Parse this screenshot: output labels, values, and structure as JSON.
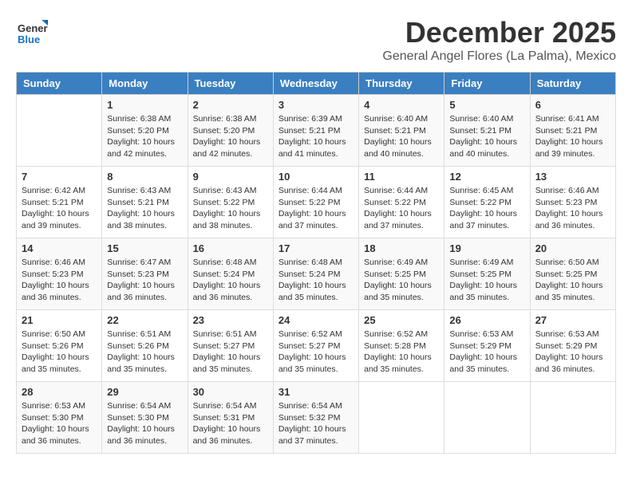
{
  "logo": {
    "line1": "General",
    "line2": "Blue"
  },
  "header": {
    "month_year": "December 2025",
    "location": "General Angel Flores (La Palma), Mexico"
  },
  "days_of_week": [
    "Sunday",
    "Monday",
    "Tuesday",
    "Wednesday",
    "Thursday",
    "Friday",
    "Saturday"
  ],
  "weeks": [
    [
      {
        "day": "",
        "info": ""
      },
      {
        "day": "1",
        "info": "Sunrise: 6:38 AM\nSunset: 5:20 PM\nDaylight: 10 hours\nand 42 minutes."
      },
      {
        "day": "2",
        "info": "Sunrise: 6:38 AM\nSunset: 5:20 PM\nDaylight: 10 hours\nand 42 minutes."
      },
      {
        "day": "3",
        "info": "Sunrise: 6:39 AM\nSunset: 5:21 PM\nDaylight: 10 hours\nand 41 minutes."
      },
      {
        "day": "4",
        "info": "Sunrise: 6:40 AM\nSunset: 5:21 PM\nDaylight: 10 hours\nand 40 minutes."
      },
      {
        "day": "5",
        "info": "Sunrise: 6:40 AM\nSunset: 5:21 PM\nDaylight: 10 hours\nand 40 minutes."
      },
      {
        "day": "6",
        "info": "Sunrise: 6:41 AM\nSunset: 5:21 PM\nDaylight: 10 hours\nand 39 minutes."
      }
    ],
    [
      {
        "day": "7",
        "info": "Sunrise: 6:42 AM\nSunset: 5:21 PM\nDaylight: 10 hours\nand 39 minutes."
      },
      {
        "day": "8",
        "info": "Sunrise: 6:43 AM\nSunset: 5:21 PM\nDaylight: 10 hours\nand 38 minutes."
      },
      {
        "day": "9",
        "info": "Sunrise: 6:43 AM\nSunset: 5:22 PM\nDaylight: 10 hours\nand 38 minutes."
      },
      {
        "day": "10",
        "info": "Sunrise: 6:44 AM\nSunset: 5:22 PM\nDaylight: 10 hours\nand 37 minutes."
      },
      {
        "day": "11",
        "info": "Sunrise: 6:44 AM\nSunset: 5:22 PM\nDaylight: 10 hours\nand 37 minutes."
      },
      {
        "day": "12",
        "info": "Sunrise: 6:45 AM\nSunset: 5:22 PM\nDaylight: 10 hours\nand 37 minutes."
      },
      {
        "day": "13",
        "info": "Sunrise: 6:46 AM\nSunset: 5:23 PM\nDaylight: 10 hours\nand 36 minutes."
      }
    ],
    [
      {
        "day": "14",
        "info": "Sunrise: 6:46 AM\nSunset: 5:23 PM\nDaylight: 10 hours\nand 36 minutes."
      },
      {
        "day": "15",
        "info": "Sunrise: 6:47 AM\nSunset: 5:23 PM\nDaylight: 10 hours\nand 36 minutes."
      },
      {
        "day": "16",
        "info": "Sunrise: 6:48 AM\nSunset: 5:24 PM\nDaylight: 10 hours\nand 36 minutes."
      },
      {
        "day": "17",
        "info": "Sunrise: 6:48 AM\nSunset: 5:24 PM\nDaylight: 10 hours\nand 35 minutes."
      },
      {
        "day": "18",
        "info": "Sunrise: 6:49 AM\nSunset: 5:25 PM\nDaylight: 10 hours\nand 35 minutes."
      },
      {
        "day": "19",
        "info": "Sunrise: 6:49 AM\nSunset: 5:25 PM\nDaylight: 10 hours\nand 35 minutes."
      },
      {
        "day": "20",
        "info": "Sunrise: 6:50 AM\nSunset: 5:25 PM\nDaylight: 10 hours\nand 35 minutes."
      }
    ],
    [
      {
        "day": "21",
        "info": "Sunrise: 6:50 AM\nSunset: 5:26 PM\nDaylight: 10 hours\nand 35 minutes."
      },
      {
        "day": "22",
        "info": "Sunrise: 6:51 AM\nSunset: 5:26 PM\nDaylight: 10 hours\nand 35 minutes."
      },
      {
        "day": "23",
        "info": "Sunrise: 6:51 AM\nSunset: 5:27 PM\nDaylight: 10 hours\nand 35 minutes."
      },
      {
        "day": "24",
        "info": "Sunrise: 6:52 AM\nSunset: 5:27 PM\nDaylight: 10 hours\nand 35 minutes."
      },
      {
        "day": "25",
        "info": "Sunrise: 6:52 AM\nSunset: 5:28 PM\nDaylight: 10 hours\nand 35 minutes."
      },
      {
        "day": "26",
        "info": "Sunrise: 6:53 AM\nSunset: 5:29 PM\nDaylight: 10 hours\nand 35 minutes."
      },
      {
        "day": "27",
        "info": "Sunrise: 6:53 AM\nSunset: 5:29 PM\nDaylight: 10 hours\nand 36 minutes."
      }
    ],
    [
      {
        "day": "28",
        "info": "Sunrise: 6:53 AM\nSunset: 5:30 PM\nDaylight: 10 hours\nand 36 minutes."
      },
      {
        "day": "29",
        "info": "Sunrise: 6:54 AM\nSunset: 5:30 PM\nDaylight: 10 hours\nand 36 minutes."
      },
      {
        "day": "30",
        "info": "Sunrise: 6:54 AM\nSunset: 5:31 PM\nDaylight: 10 hours\nand 36 minutes."
      },
      {
        "day": "31",
        "info": "Sunrise: 6:54 AM\nSunset: 5:32 PM\nDaylight: 10 hours\nand 37 minutes."
      },
      {
        "day": "",
        "info": ""
      },
      {
        "day": "",
        "info": ""
      },
      {
        "day": "",
        "info": ""
      }
    ]
  ]
}
